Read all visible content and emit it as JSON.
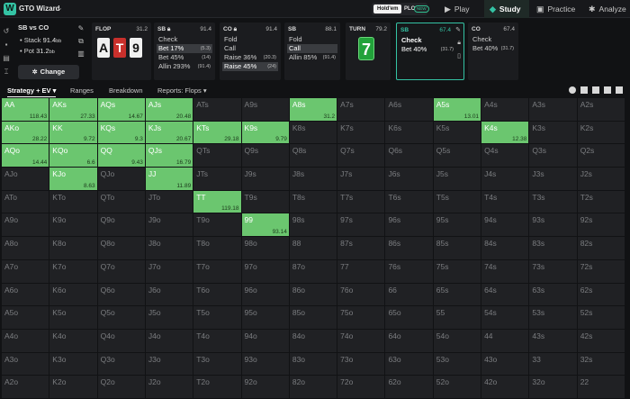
{
  "topbar": {
    "logo_letter": "W",
    "app_title": "GTO Wizard",
    "game_holdem": "Hold'em",
    "game_plo": "PLO",
    "game_plo_badge": "NEW",
    "nav": [
      {
        "label": "Play",
        "icon": "play-icon"
      },
      {
        "label": "Study",
        "icon": "graduation-cap-icon"
      },
      {
        "label": "Practice",
        "icon": "gamepad-icon"
      },
      {
        "label": "Analyze",
        "icon": "lightbulb-icon"
      }
    ]
  },
  "spot": {
    "title": "SB vs CO",
    "stack_label": "Stack",
    "stack_value": "91.4",
    "stack_unit": "bb",
    "pot_label": "Pot",
    "pot_value": "31.2",
    "pot_unit": "bb",
    "change_label": "Change"
  },
  "panels": {
    "flop": {
      "title": "FLOP",
      "pot": "31.2",
      "cards": [
        "A",
        "T",
        "9"
      ]
    },
    "sb1": {
      "title": "SB",
      "pot": "91.4",
      "actions": [
        {
          "label": "Check",
          "freq": ""
        },
        {
          "label": "Bet 17%",
          "freq": "(5.3)"
        },
        {
          "label": "Bet 45%",
          "freq": "(14)"
        },
        {
          "label": "Allin 293%",
          "freq": "(91.4)"
        }
      ]
    },
    "co1": {
      "title": "CO",
      "pot": "91.4",
      "actions": [
        {
          "label": "Fold",
          "freq": ""
        },
        {
          "label": "Call",
          "freq": ""
        },
        {
          "label": "Raise 36%",
          "freq": "(20.3)"
        },
        {
          "label": "Raise 45%",
          "freq": "(24)"
        }
      ]
    },
    "sb2": {
      "title": "SB",
      "pot": "88.1",
      "actions": [
        {
          "label": "Fold",
          "freq": ""
        },
        {
          "label": "Call",
          "freq": ""
        },
        {
          "label": "Allin 85%",
          "freq": "(91.4)"
        }
      ]
    },
    "turn": {
      "title": "TURN",
      "pot": "79.2",
      "card": "7"
    },
    "sb3": {
      "title": "SB",
      "pot": "67.4",
      "actions": [
        {
          "label": "Check",
          "freq": ""
        },
        {
          "label": "Bet 40%",
          "freq": "(31.7)"
        }
      ]
    },
    "co2": {
      "title": "CO",
      "pot": "67.4",
      "actions": [
        {
          "label": "Check",
          "freq": ""
        },
        {
          "label": "Bet 40%",
          "freq": "(31.7)"
        }
      ]
    }
  },
  "tabs": [
    "Strategy + EV",
    "Ranges",
    "Breakdown",
    "Reports: Flops"
  ],
  "grid": {
    "rows": [
      [
        "AA",
        "AKs",
        "AQs",
        "AJs",
        "ATs",
        "A9s",
        "A8s",
        "A7s",
        "A6s",
        "A5s",
        "A4s",
        "A3s",
        "A2s"
      ],
      [
        "AKo",
        "KK",
        "KQs",
        "KJs",
        "KTs",
        "K9s",
        "K8s",
        "K7s",
        "K6s",
        "K5s",
        "K4s",
        "K3s",
        "K2s"
      ],
      [
        "AQo",
        "KQo",
        "QQ",
        "QJs",
        "QTs",
        "Q9s",
        "Q8s",
        "Q7s",
        "Q6s",
        "Q5s",
        "Q4s",
        "Q3s",
        "Q2s"
      ],
      [
        "AJo",
        "KJo",
        "QJo",
        "JJ",
        "JTs",
        "J9s",
        "J8s",
        "J7s",
        "J6s",
        "J5s",
        "J4s",
        "J3s",
        "J2s"
      ],
      [
        "ATo",
        "KTo",
        "QTo",
        "JTo",
        "TT",
        "T9s",
        "T8s",
        "T7s",
        "T6s",
        "T5s",
        "T4s",
        "T3s",
        "T2s"
      ],
      [
        "A9o",
        "K9o",
        "Q9o",
        "J9o",
        "T9o",
        "99",
        "98s",
        "97s",
        "96s",
        "95s",
        "94s",
        "93s",
        "92s"
      ],
      [
        "A8o",
        "K8o",
        "Q8o",
        "J8o",
        "T8o",
        "98o",
        "88",
        "87s",
        "86s",
        "85s",
        "84s",
        "83s",
        "82s"
      ],
      [
        "A7o",
        "K7o",
        "Q7o",
        "J7o",
        "T7o",
        "97o",
        "87o",
        "77",
        "76s",
        "75s",
        "74s",
        "73s",
        "72s"
      ],
      [
        "A6o",
        "K6o",
        "Q6o",
        "J6o",
        "T6o",
        "96o",
        "86o",
        "76o",
        "66",
        "65s",
        "64s",
        "63s",
        "62s"
      ],
      [
        "A5o",
        "K5o",
        "Q5o",
        "J5o",
        "T5o",
        "95o",
        "85o",
        "75o",
        "65o",
        "55",
        "54s",
        "53s",
        "52s"
      ],
      [
        "A4o",
        "K4o",
        "Q4o",
        "J4o",
        "T4o",
        "94o",
        "84o",
        "74o",
        "64o",
        "54o",
        "44",
        "43s",
        "42s"
      ],
      [
        "A3o",
        "K3o",
        "Q3o",
        "J3o",
        "T3o",
        "93o",
        "83o",
        "73o",
        "63o",
        "53o",
        "43o",
        "33",
        "32s"
      ],
      [
        "A2o",
        "K2o",
        "Q2o",
        "J2o",
        "T2o",
        "92o",
        "82o",
        "72o",
        "62o",
        "52o",
        "42o",
        "32o",
        "22"
      ]
    ],
    "ev": {
      "AA": "118.43",
      "AKs": "27.33",
      "AQs": "14.67",
      "AJs": "20.48",
      "A8s": "31.2",
      "A5s": "13.01",
      "AKo": "28.22",
      "KK": "9.72",
      "KQs": "9.3",
      "KJs": "20.67",
      "KTs": "29.18",
      "K9s": "9.79",
      "K4s": "12.38",
      "AQo": "14.44",
      "KQo": "6.6",
      "QQ": "9.43",
      "QJs": "16.79",
      "KJo": "8.63",
      "JJ": "11.89",
      "TT": "119.18",
      "99": "93.14"
    },
    "highlight_color": "#6bc66f"
  }
}
